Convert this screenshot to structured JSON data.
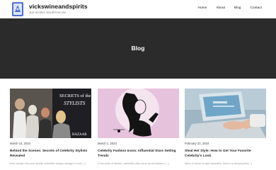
{
  "site": {
    "title": "vickswineandspirits",
    "tagline": "Just another WordPress site"
  },
  "nav": {
    "items": [
      "Home",
      "About",
      "Blog",
      "Contact"
    ]
  },
  "hero": {
    "title": "Blog"
  },
  "posts": [
    {
      "date": "March 14, 2024",
      "title": "Behind the Scenes: Secrets of Celebrity Stylists Revealed",
      "excerpt": "Ever wonder how your favorite celebrities always manage to look [...]",
      "image_text_top": "SECRETS of the",
      "image_text_mid": "STYLISTS",
      "image_text_bottom": "BAZAAR"
    },
    {
      "date": "March 1, 2024",
      "title": "Celebrity Fashion Icons: Influential Stars Setting Trends",
      "excerpt": "In the world of fashion, celebrities often serve as trendsetters, [...]"
    },
    {
      "date": "February 22, 2024",
      "title": "Steal Her Style: How to Get Your Favorite Celebrity's Look",
      "excerpt": "When it comes to style inspiration, there's no denying that [...]"
    }
  ],
  "colors": {
    "hero_bg": "#2b2b2b",
    "card2_bg": "#e6c2dd",
    "logo_blue": "#4a6fd8"
  }
}
